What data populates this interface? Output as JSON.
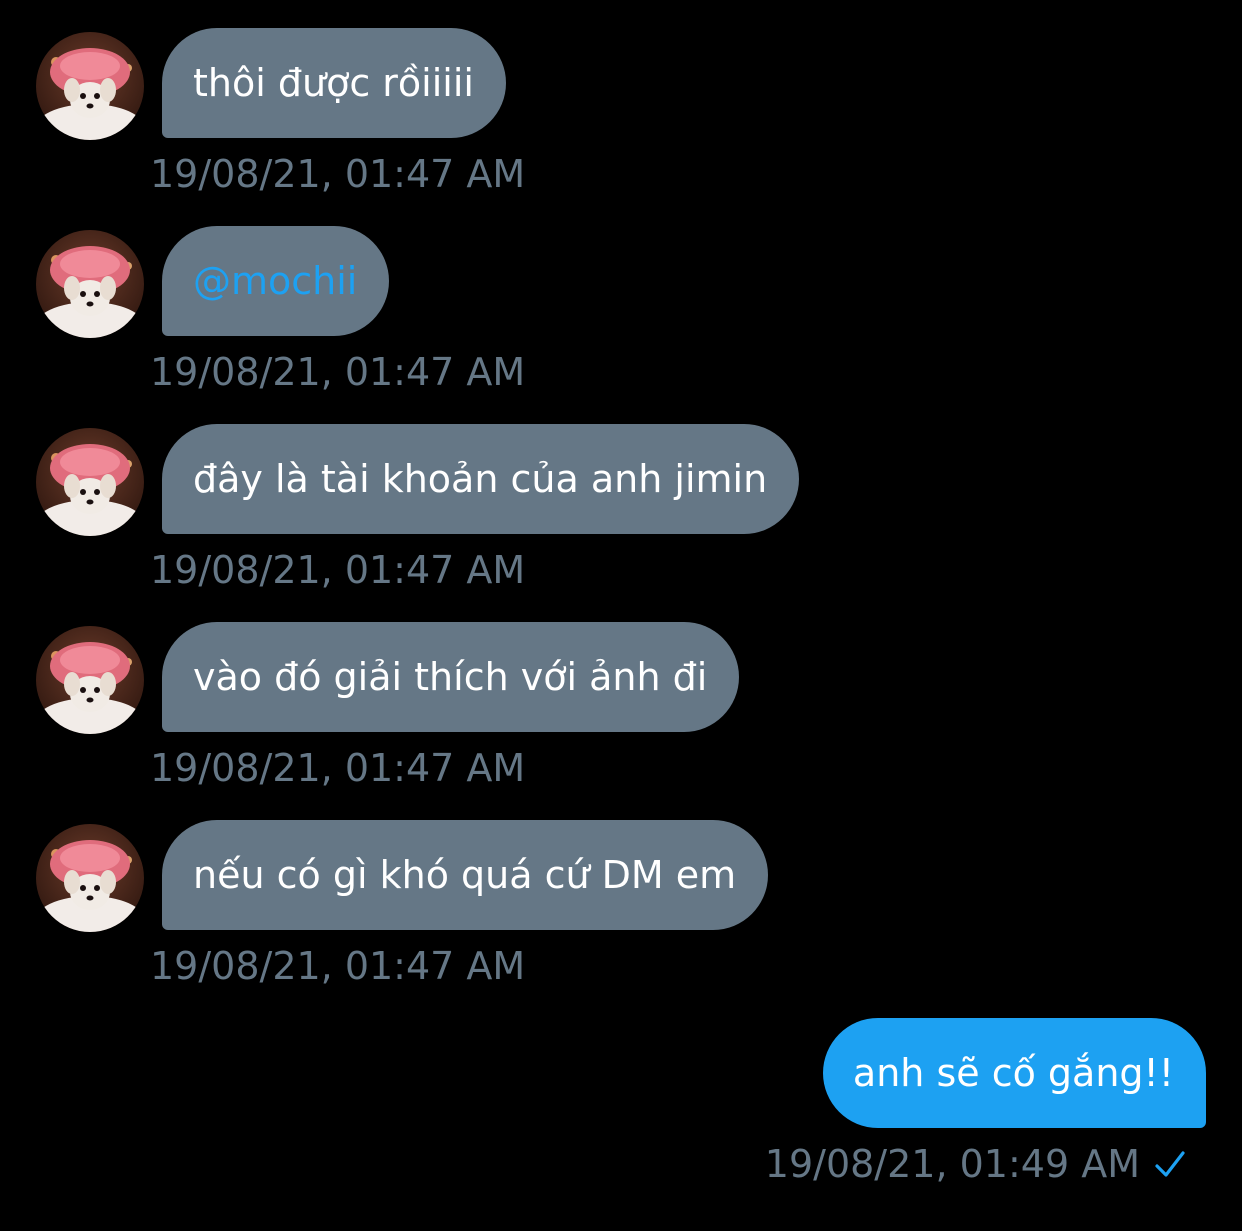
{
  "colors": {
    "background": "#000000",
    "received_bubble": "#657786",
    "sent_bubble": "#1da1f2",
    "mention": "#1da1f2",
    "timestamp": "#657786"
  },
  "messages": [
    {
      "direction": "received",
      "text": "thôi được rồiiiii",
      "timestamp": "19/08/21, 01:47 AM",
      "avatar_icon": "dog-avatar-icon"
    },
    {
      "direction": "received",
      "text": "@mochii",
      "timestamp": "19/08/21, 01:47 AM",
      "avatar_icon": "dog-avatar-icon",
      "is_mention": true
    },
    {
      "direction": "received",
      "text": "đây là tài khoản của anh jimin",
      "timestamp": "19/08/21, 01:47 AM",
      "avatar_icon": "dog-avatar-icon"
    },
    {
      "direction": "received",
      "text": "vào đó giải thích với ảnh đi",
      "timestamp": "19/08/21, 01:47 AM",
      "avatar_icon": "dog-avatar-icon"
    },
    {
      "direction": "received",
      "text": "nếu có gì khó quá cứ DM em",
      "timestamp": "19/08/21, 01:47 AM",
      "avatar_icon": "dog-avatar-icon"
    },
    {
      "direction": "sent",
      "text": "anh sẽ cố gắng!!",
      "timestamp": "19/08/21, 01:49 AM",
      "status_icon": "checkmark-icon"
    }
  ]
}
